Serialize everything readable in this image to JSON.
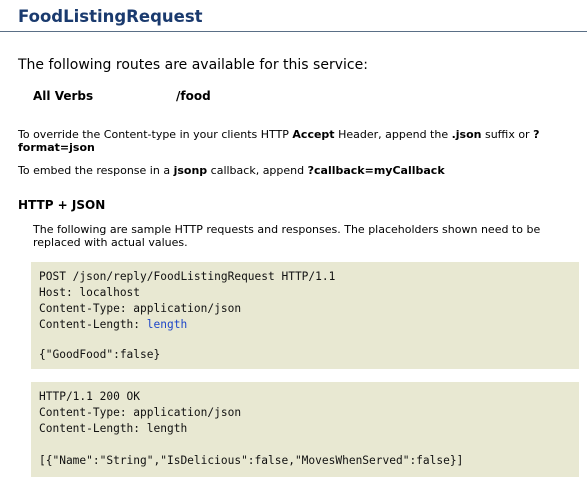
{
  "title": "FoodListingRequest",
  "intro": "The following routes are available for this service:",
  "routes": [
    {
      "verbs": "All Verbs",
      "path": "/food"
    }
  ],
  "override": {
    "t1": "To override the Content-type in your clients HTTP ",
    "b1": "Accept",
    "t2": " Header, append the ",
    "b2": ".json",
    "t3": " suffix or ",
    "b3": "?format=json"
  },
  "embed": {
    "t1": "To embed the response in a ",
    "b1": "jsonp",
    "t2": " callback, append ",
    "b2": "?callback=myCallback"
  },
  "section": "HTTP + JSON",
  "description": "The following are sample HTTP requests and responses. The placeholders shown need to be replaced with actual values.",
  "request": {
    "line1": "POST /json/reply/FoodListingRequest HTTP/1.1",
    "line2": "Host: localhost",
    "line3": "Content-Type: application/json",
    "line4_label": "Content-Length: ",
    "line4_value": "length",
    "body": "{\"GoodFood\":false}"
  },
  "response": {
    "line1": "HTTP/1.1 200 OK",
    "line2": "Content-Type: application/json",
    "line3": "Content-Length: length",
    "body": "[{\"Name\":\"String\",\"IsDelicious\":false,\"MovesWhenServed\":false}]"
  },
  "colors": {
    "title": "#1a3a6e",
    "code_bg": "#e8e8d2",
    "placeholder": "#1e46c8"
  }
}
